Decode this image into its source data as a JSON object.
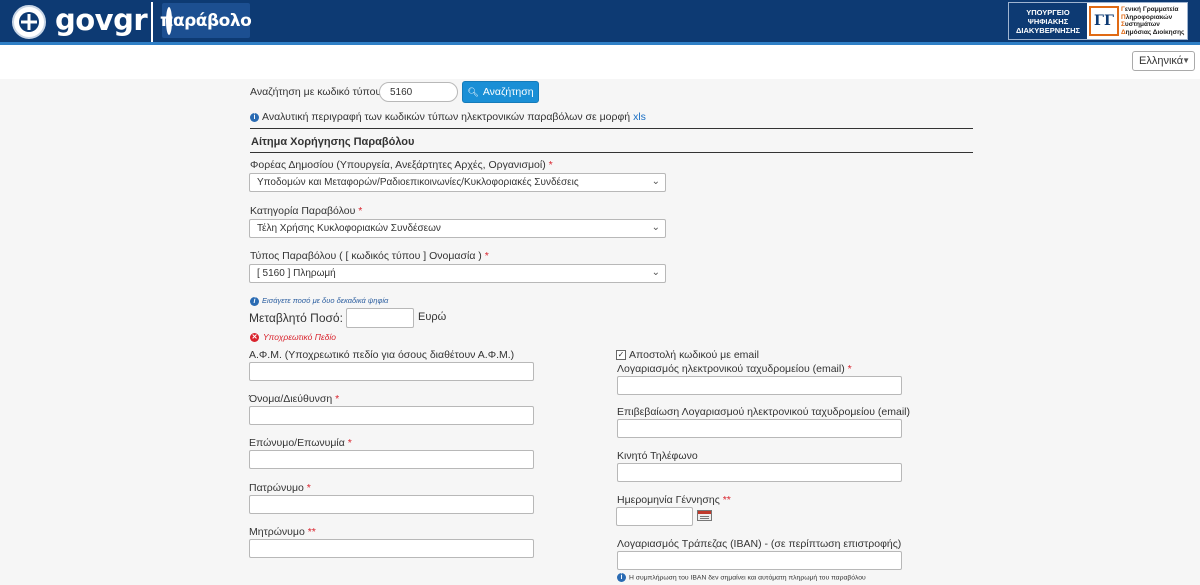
{
  "header": {
    "brand": "gov",
    "brand_suffix": "gr",
    "app_name": "παράβολο",
    "ministry_lines": [
      "ΥΠΟΥΡΓΕΙΟ",
      "ΨΗΦΙΑΚΗΣ",
      "ΔΙΑΚΥΒΕΡΝΗΣΗΣ"
    ],
    "gg_lines": [
      "Γενική Γραμματεία",
      "Πληροφοριακών",
      "Συστημάτων",
      "Δημόσιας Διοίκησης"
    ],
    "colors": {
      "topbar": "#0d3a73",
      "accent_line": "#2f7fc6"
    }
  },
  "language": {
    "selected": "Ελληνικά"
  },
  "search": {
    "label": "Αναζήτηση με κωδικό τύπου",
    "value": "5160",
    "button_label": "Αναζήτηση",
    "info_text": "Αναλυτική περιγραφή των κωδικών τύπων ηλεκτρονικών παραβόλων σε μορφή",
    "xls_link": "xls"
  },
  "section": {
    "title": "Αίτημα Χορήγησης Παραβόλου"
  },
  "form": {
    "agency": {
      "label": "Φορέας Δημοσίου (Υπουργεία, Ανεξάρτητες Αρχές, Οργανισμοί)",
      "required": "*",
      "value": "Υποδομών και Μεταφορών/Ραδιοεπικοινωνίες/Κυκλοφοριακές Συνδέσεις"
    },
    "category": {
      "label": "Κατηγορία Παραβόλου",
      "required": "*",
      "value": "Τέλη Χρήσης Κυκλοφοριακών Συνδέσεων"
    },
    "type": {
      "label": "Τύπος Παραβόλου ( [ κωδικός τύπου ] Ονομασία )",
      "required": "*",
      "value": "[ 5160 ] Πληρωμή"
    },
    "amount_hint": "Εισάγετε ποσό με δυο δεκαδικά ψηφία",
    "amount": {
      "label": "Μεταβλητό Ποσό:",
      "value": "",
      "currency": "Ευρώ",
      "error": "Υποχρεωτικό Πεδίο"
    },
    "left": {
      "afm": {
        "label": "Α.Φ.Μ. (Υποχρεωτικό πεδίο για όσους διαθέτουν Α.Φ.Μ.)",
        "value": ""
      },
      "name": {
        "label": "Όνομα/Διεύθυνση",
        "required": "*",
        "value": ""
      },
      "surname": {
        "label": "Επώνυμο/Επωνυμία",
        "required": "*",
        "value": ""
      },
      "father": {
        "label": "Πατρώνυμο",
        "required": "*",
        "value": ""
      },
      "mother": {
        "label": "Μητρώνυμο",
        "required": "**",
        "value": ""
      }
    },
    "right": {
      "send_email": {
        "label": "Αποστολή κωδικού με email",
        "checked": true,
        "mark": "✓"
      },
      "email": {
        "label": "Λογαριασμός ηλεκτρονικού ταχυδρομείου (email)",
        "required": "*",
        "value": ""
      },
      "email_confirm": {
        "label": "Επιβεβαίωση Λογαριασμού ηλεκτρονικού ταχυδρομείου (email)",
        "value": ""
      },
      "mobile": {
        "label": "Κινητό Τηλέφωνο",
        "value": ""
      },
      "birthdate": {
        "label": "Ημερομηνία Γέννησης",
        "required": "**",
        "value": ""
      },
      "iban": {
        "label": "Λογαριασμός Τράπεζας (IBAN) - (σε περίπτωση επιστροφής)",
        "value": "",
        "note": "Η συμπλήρωση του IBAN δεν σημαίνει και αυτόματη πληρωμή του παραβόλου"
      }
    }
  }
}
